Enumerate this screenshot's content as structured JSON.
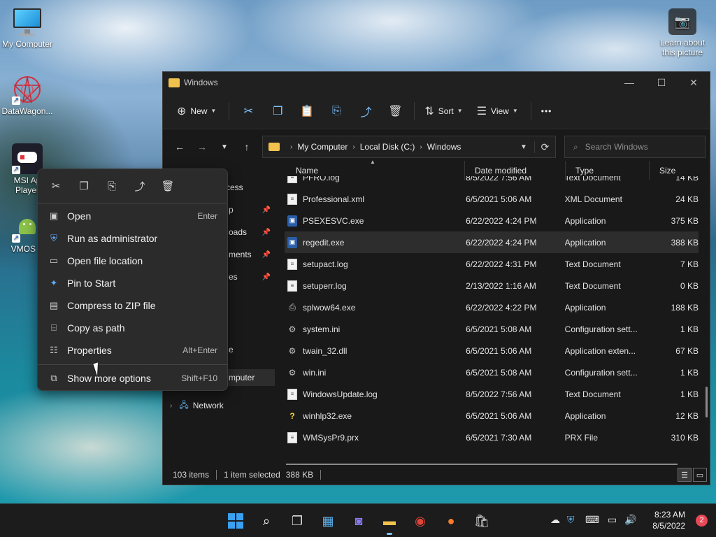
{
  "desktop": {
    "icons": [
      {
        "label": "My Computer"
      },
      {
        "label": "DataWagon..."
      },
      {
        "label": "MSI Ap",
        "label2": "Player"
      },
      {
        "label": "VMOS P"
      }
    ],
    "learn_label": "Learn about this picture"
  },
  "window": {
    "title": "Windows",
    "controls": {
      "minimize": "—",
      "maximize": "☐",
      "close": "✕"
    },
    "toolbar": {
      "new_label": "New",
      "sort_label": "Sort",
      "view_label": "View",
      "more_label": "•••"
    },
    "address": {
      "crumbs": [
        "My Computer",
        "Local Disk (C:)",
        "Windows"
      ],
      "search_placeholder": "Search Windows"
    },
    "navpane": {
      "items": [
        {
          "label": "ccess"
        },
        {
          "label": "p"
        },
        {
          "label": "oads"
        },
        {
          "label": "ments"
        },
        {
          "label": "es"
        },
        {
          "label": "e"
        },
        {
          "label": "mputer"
        },
        {
          "label": "Network"
        }
      ]
    },
    "columns": {
      "name": "Name",
      "date": "Date modified",
      "type": "Type",
      "size": "Size"
    },
    "files": [
      {
        "name": "PFRO.log",
        "date": "8/5/2022 7:56 AM",
        "type": "Text Document",
        "size": "14 KB",
        "icon": "doc"
      },
      {
        "name": "Professional.xml",
        "date": "6/5/2021 5:06 AM",
        "type": "XML Document",
        "size": "24 KB",
        "icon": "doc"
      },
      {
        "name": "PSEXESVC.exe",
        "date": "6/22/2022 4:24 PM",
        "type": "Application",
        "size": "375 KB",
        "icon": "app"
      },
      {
        "name": "regedit.exe",
        "date": "6/22/2022 4:24 PM",
        "type": "Application",
        "size": "388 KB",
        "icon": "app",
        "selected": true
      },
      {
        "name": "setupact.log",
        "date": "6/22/2022 4:31 PM",
        "type": "Text Document",
        "size": "7 KB",
        "icon": "doc"
      },
      {
        "name": "setuperr.log",
        "date": "2/13/2022 1:16 AM",
        "type": "Text Document",
        "size": "0 KB",
        "icon": "doc"
      },
      {
        "name": "splwow64.exe",
        "date": "6/22/2022 4:22 PM",
        "type": "Application",
        "size": "188 KB",
        "icon": "printer"
      },
      {
        "name": "system.ini",
        "date": "6/5/2021 5:08 AM",
        "type": "Configuration sett...",
        "size": "1 KB",
        "icon": "gear"
      },
      {
        "name": "twain_32.dll",
        "date": "6/5/2021 5:06 AM",
        "type": "Application exten...",
        "size": "67 KB",
        "icon": "gear"
      },
      {
        "name": "win.ini",
        "date": "6/5/2021 5:08 AM",
        "type": "Configuration sett...",
        "size": "1 KB",
        "icon": "gear"
      },
      {
        "name": "WindowsUpdate.log",
        "date": "8/5/2022 7:56 AM",
        "type": "Text Document",
        "size": "1 KB",
        "icon": "doc"
      },
      {
        "name": "winhlp32.exe",
        "date": "6/5/2021 5:06 AM",
        "type": "Application",
        "size": "12 KB",
        "icon": "help"
      },
      {
        "name": "WMSysPr9.prx",
        "date": "6/5/2021 7:30 AM",
        "type": "PRX File",
        "size": "310 KB",
        "icon": "doc"
      }
    ],
    "status": {
      "count": "103 items",
      "selected": "1 item selected",
      "size": "388 KB"
    }
  },
  "context_menu": {
    "items": [
      {
        "label": "Open",
        "accel": "Enter",
        "icon": "open-icon"
      },
      {
        "label": "Run as administrator",
        "accel": "",
        "icon": "shield-icon"
      },
      {
        "label": "Open file location",
        "accel": "",
        "icon": "folder-icon"
      },
      {
        "label": "Pin to Start",
        "accel": "",
        "icon": "pin-icon"
      },
      {
        "label": "Compress to ZIP file",
        "accel": "",
        "icon": "zip-icon"
      },
      {
        "label": "Copy as path",
        "accel": "",
        "icon": "path-icon"
      },
      {
        "label": "Properties",
        "accel": "Alt+Enter",
        "icon": "properties-icon"
      }
    ],
    "more": {
      "label": "Show more options",
      "accel": "Shift+F10"
    }
  },
  "taskbar": {
    "time": "8:23 AM",
    "date": "8/5/2022",
    "notification_count": "2"
  }
}
